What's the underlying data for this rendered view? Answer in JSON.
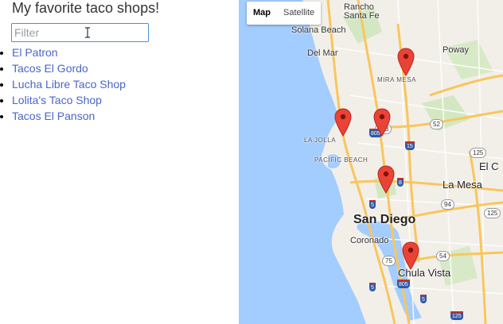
{
  "page": {
    "title": "My favorite taco shops!"
  },
  "filter": {
    "placeholder": "Filter",
    "value": ""
  },
  "shops": [
    {
      "label": "El Patron"
    },
    {
      "label": "Tacos El Gordo"
    },
    {
      "label": "Lucha Libre Taco Shop"
    },
    {
      "label": "Lolita's Taco Shop"
    },
    {
      "label": "Tacos El Panson"
    }
  ],
  "map": {
    "type_buttons": {
      "map": "Map",
      "satellite": "Satellite"
    },
    "places": {
      "rancho": "Rancho",
      "santa_fe": "Santa Fe",
      "solana_beach": "Solana Beach",
      "del_mar": "Del Mar",
      "poway": "Poway",
      "mira_mesa": "MIRA MESA",
      "la_jolla": "LA JOLLA",
      "pacific_beach": "PACIFIC BEACH",
      "el_cajon": "El C",
      "la_mesa": "La Mesa",
      "san_diego": "San Diego",
      "coronado": "Coronado",
      "chula_vista": "Chula Vista"
    },
    "highways": [
      "163",
      "52",
      "125",
      "15",
      "805",
      "8",
      "5",
      "94",
      "125",
      "54",
      "75",
      "805",
      "5",
      "5",
      "125"
    ],
    "colors": {
      "water": "#a3ccff",
      "land": "#f2efe9",
      "highway": "#f9c65b",
      "park": "#c6e5b1",
      "marker": "#ea4335"
    }
  }
}
